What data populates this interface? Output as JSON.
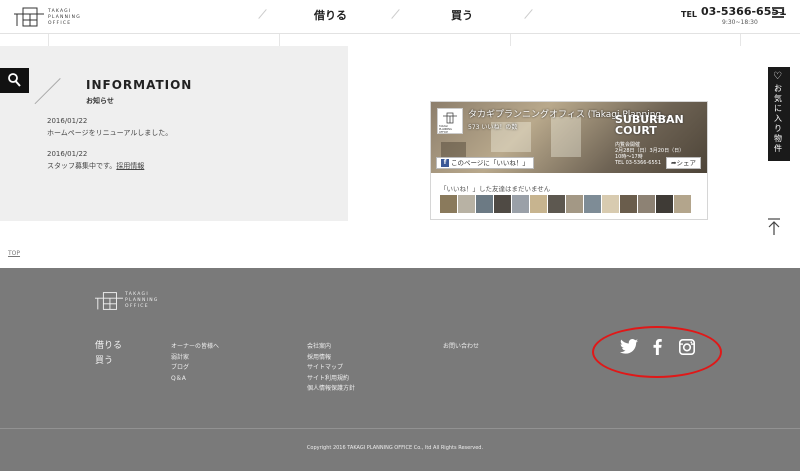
{
  "header": {
    "logo_lines": [
      "TAKAGI",
      "PLANNING",
      "OFFICE"
    ],
    "nav": [
      "借りる",
      "買う"
    ],
    "tel_label": "TEL",
    "tel_number": "03-5366-6551",
    "hours": "9:30~18:30",
    "menu_icon": "hamburger-icon"
  },
  "info": {
    "title": "INFORMATION",
    "subtitle": "お知らせ",
    "news": [
      {
        "date": "2016/01/22",
        "text": "ホームページをリニューアルしました。",
        "link": ""
      },
      {
        "date": "2016/01/22",
        "text": "スタッフ募集中です。",
        "link": "採用情報"
      }
    ]
  },
  "facebook": {
    "page_name": "タカギプランニングオフィス (Takagi Planning...",
    "likes": "573 いいね！の数",
    "overlay_big": [
      "SUBURBAN",
      "COURT"
    ],
    "overlay_small": [
      "内覧会開催",
      "2月28日（日）3月20日（日）",
      "10時～17時",
      "TEL 03-5366-6551"
    ],
    "like_button": "このページに「いいね！」",
    "share_button": "シェア",
    "friends_text": "「いいね！」した友達はまだいません",
    "avatar_lines": [
      "TAKAGI",
      "PLANNING",
      "OFFICE"
    ]
  },
  "side_tab": {
    "label": "お気に入り物件",
    "icon": "heart-icon"
  },
  "top_link": "TOP",
  "footer": {
    "logo_lines": [
      "TAKAGI",
      "PLANNING",
      "OFFICE"
    ],
    "main": [
      "借りる",
      "買う"
    ],
    "col1": [
      "オーナーの皆様へ",
      "弱計家",
      "ブログ",
      "Q＆A"
    ],
    "col2": [
      "会社案内",
      "採用情報",
      "サイトマップ",
      "サイト利用規約",
      "個人情報保護方針"
    ],
    "col3": [
      "お問い合わせ"
    ],
    "social": [
      "twitter-icon",
      "facebook-icon",
      "instagram-icon"
    ],
    "copyright": "Copyright 2016 TAKAGI PLANNING OFFICE Co., ltd All Rights Reserved.",
    "highlight_color": "#e01818"
  }
}
